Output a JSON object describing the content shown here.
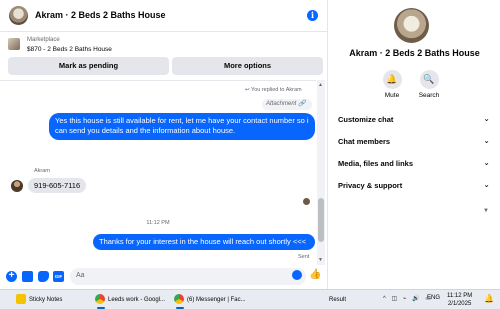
{
  "chat": {
    "title": "Akram · 2 Beds 2 Baths House",
    "info_icon": "i",
    "listing": {
      "category": "Marketplace",
      "price_title": "$870 - 2 Beds 2 Baths House",
      "mark_pending": "Mark as pending",
      "more_options": "More options"
    },
    "messages": {
      "replied_note": "↩ You replied to Akram",
      "attachment": "Attachment 🔗",
      "outgoing_1": "Yes this house is still available for rent, let me have your contact number so i can send you details and the information about house.",
      "sender_name": "Akram",
      "incoming_1": "919-605-7116",
      "time": "11:12 PM",
      "outgoing_2": "Thanks for your interest in the house will reach out shortly <<<",
      "status": "Sent"
    },
    "composer": {
      "placeholder": "Aa",
      "plus": "+",
      "gif": "GIF",
      "like": "👍"
    }
  },
  "side_panel": {
    "title": "Akram · 2 Beds 2 Baths House",
    "actions": [
      {
        "label": "Mute",
        "icon": "🔔"
      },
      {
        "label": "Search",
        "icon": "🔍"
      }
    ],
    "sections": [
      "Customize chat",
      "Chat members",
      "Media, files and links",
      "Privacy & support"
    ],
    "chevron": "⌄"
  },
  "taskbar": {
    "items": [
      "Sticky Notes",
      "Leeds work - Googl...",
      "(6) Messenger | Fac..."
    ],
    "widget": "Result",
    "tray": "^ ◫ ⌁ 🔊 ▭",
    "language": "ENG",
    "time": "11:12 PM",
    "date": "2/1/2025",
    "notif": "🔔"
  }
}
